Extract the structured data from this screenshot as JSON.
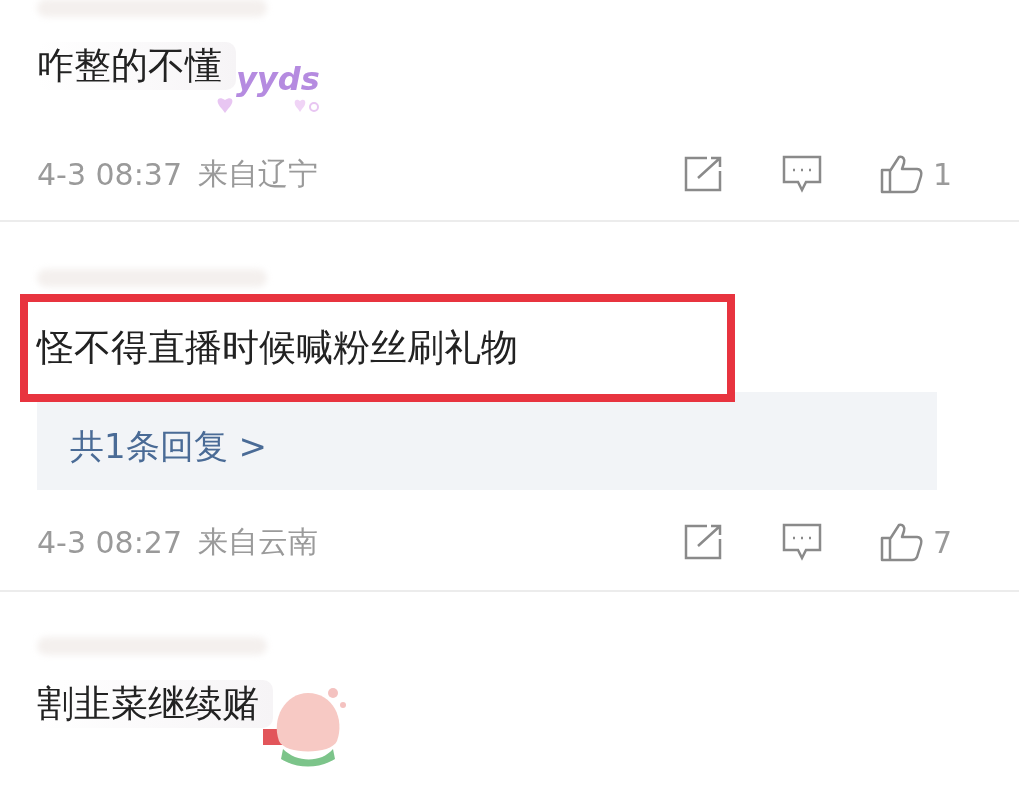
{
  "comments": [
    {
      "text": "咋整的不懂",
      "sticker": {
        "kind": "hearts",
        "text": "yyds"
      },
      "highlighted": false,
      "time": "4-3 08:37",
      "location": "来自辽宁",
      "likes": "1"
    },
    {
      "text": "怪不得直播时候喊粉丝刷礼物",
      "highlighted": true,
      "reply_link": "共1条回复 >",
      "time": "4-3 08:27",
      "location": "来自云南",
      "likes": "7"
    },
    {
      "text": "割韭菜继续赌",
      "sticker": {
        "kind": "peach"
      },
      "highlighted": false
    }
  ]
}
